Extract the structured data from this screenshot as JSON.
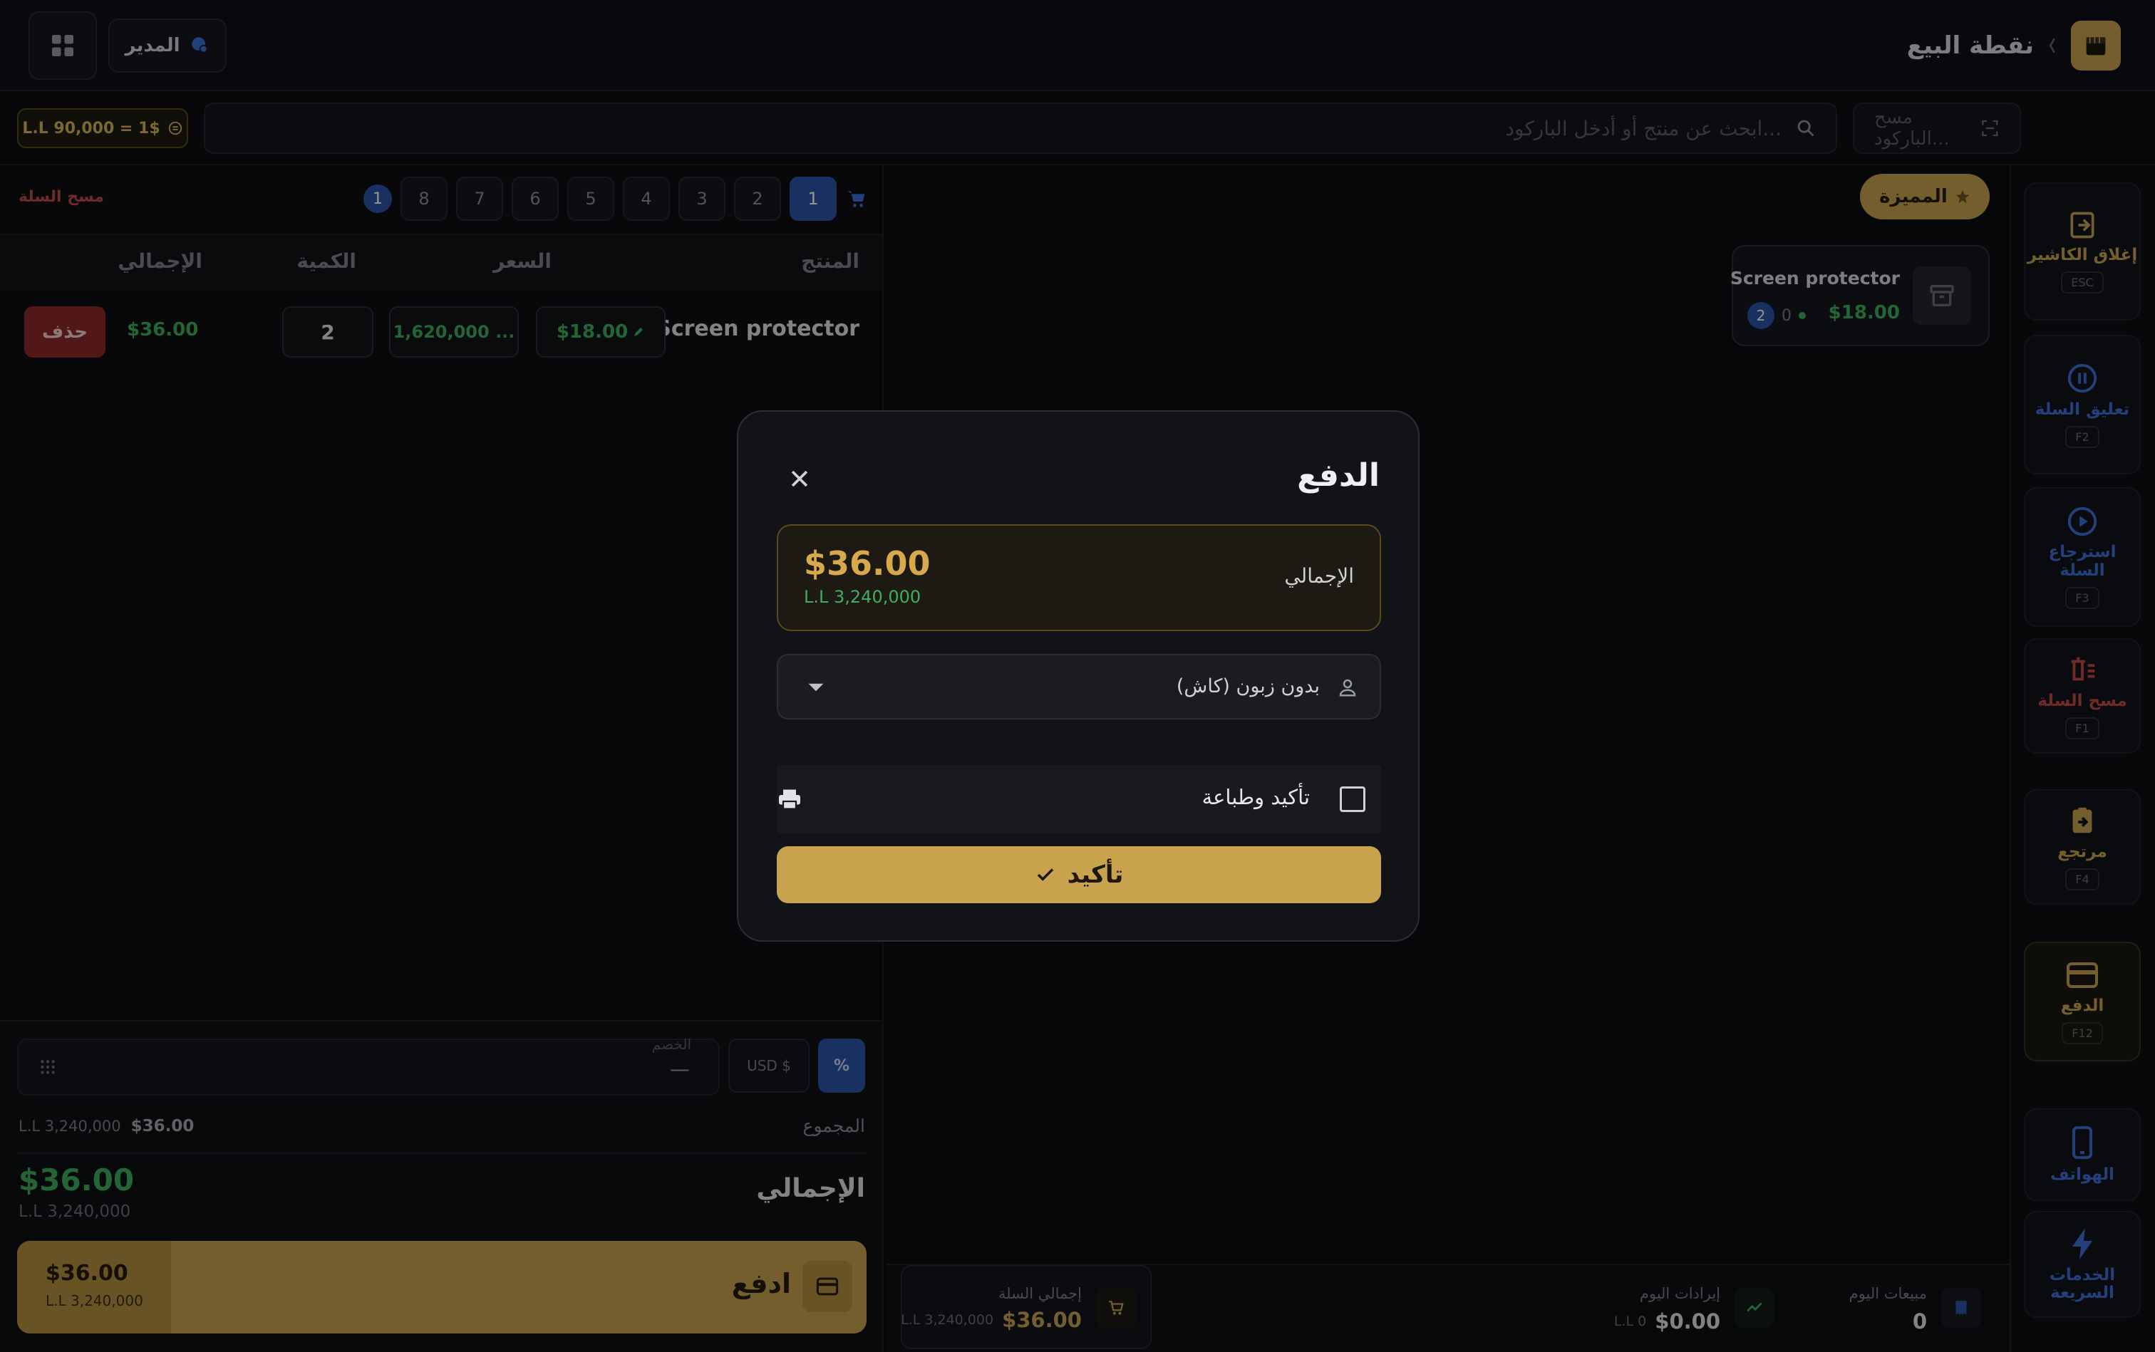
{
  "header": {
    "title": "نقطة البيع",
    "user_label": "المدير"
  },
  "toolbar": {
    "barcode_placeholder": "مسح الباركود...",
    "search_placeholder": "ابحث عن منتج أو أدخل الباركود...",
    "exchange_rate": "L.L 90,000 = 1$"
  },
  "sidebar": {
    "items": [
      {
        "label": "إغلاق الكاشير",
        "key": "ESC",
        "icon": "logout-icon"
      },
      {
        "label": "تعليق السلة",
        "key": "F2",
        "icon": "pause-icon"
      },
      {
        "label": "استرجاع السلة",
        "key": "F3",
        "icon": "play-icon"
      },
      {
        "label": "مسح السلة",
        "key": "F1",
        "icon": "trash-icon"
      },
      {
        "label": "مرتجع",
        "key": "F4",
        "icon": "return-icon"
      },
      {
        "label": "الدفع",
        "key": "F12",
        "icon": "card-icon"
      },
      {
        "label": "الهواتف",
        "icon": "phone-icon"
      },
      {
        "label": "الخدمات السريعة",
        "icon": "bolt-icon"
      }
    ]
  },
  "products": {
    "featured_label": "المميزة",
    "cards": [
      {
        "name": "Screen protector",
        "price": "$18.00",
        "stock": "0",
        "count": "2"
      }
    ]
  },
  "cart": {
    "clear_label": "مسح السلة",
    "tabs": [
      "1",
      "2",
      "3",
      "4",
      "5",
      "6",
      "7",
      "8"
    ],
    "tab_badge": "1",
    "columns": {
      "product": "المنتج",
      "price": "السعر",
      "qty": "الكمية",
      "total": "الإجمالي"
    },
    "rows": [
      {
        "product": "Screen protector",
        "price_usd": "$18.00",
        "price_ll": "1,620,000 ...",
        "qty": "2",
        "total": "$36.00",
        "delete_label": "حذف"
      }
    ],
    "discount": {
      "percent_label": "%",
      "usd_label": "USD $",
      "label": "الخصم",
      "value": "—"
    },
    "subtotal_label": "المجموع",
    "subtotal_usd": "$36.00",
    "subtotal_ll": "L.L 3,240,000",
    "total_label": "الإجمالي",
    "total_usd": "$36.00",
    "total_ll": "L.L 3,240,000",
    "pay_label": "ادفع",
    "pay_usd": "$36.00",
    "pay_ll": "L.L 3,240,000"
  },
  "stats": {
    "today_sales_label": "مبيعات اليوم",
    "today_sales_value": "0",
    "today_revenue_label": "إيرادات اليوم",
    "today_revenue_usd": "$0.00",
    "today_revenue_ll": "L.L 0",
    "cart_total_label": "إجمالي السلة",
    "cart_total_usd": "$36.00",
    "cart_total_ll": "L.L 3,240,000"
  },
  "modal": {
    "title": "الدفع",
    "total_label": "الإجمالي",
    "total_usd": "$36.00",
    "total_ll": "L.L 3,240,000",
    "customer_value": "بدون زبون (كاش)",
    "print_label": "تأكيد وطباعة",
    "confirm_label": "تأكيد"
  },
  "colors": {
    "gold": "#c9a24e",
    "green": "#3fae5e",
    "blue": "#2c55a8",
    "red": "#8e2a2a"
  }
}
